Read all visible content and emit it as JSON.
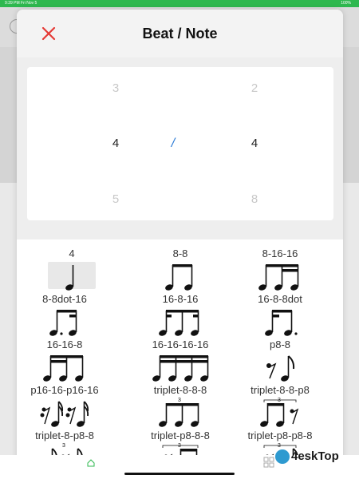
{
  "status_bar": {
    "left_text": "9:39 PM  Fri Nov 5",
    "right_text": "100%"
  },
  "modal": {
    "title": "Beat / Note",
    "close_icon": "close-x-icon"
  },
  "picker": {
    "left_column": [
      "3",
      "4",
      "5"
    ],
    "separator": "/",
    "right_column": [
      "2",
      "4",
      "8"
    ]
  },
  "notes": [
    {
      "label": "4",
      "selected": true
    },
    {
      "label": "8-8"
    },
    {
      "label": "8-16-16"
    },
    {
      "label": "8-8dot-16"
    },
    {
      "label": "16-8-16"
    },
    {
      "label": "16-8-8dot"
    },
    {
      "label": "16-16-8"
    },
    {
      "label": "16-16-16-16"
    },
    {
      "label": "p8-8"
    },
    {
      "label": "p16-16-p16-16"
    },
    {
      "label": "triplet-8-8-8"
    },
    {
      "label": "triplet-8-8-p8"
    },
    {
      "label": "triplet-8-p8-8"
    },
    {
      "label": "triplet-p8-8-8"
    },
    {
      "label": "triplet-p8-p8-8"
    }
  ],
  "tabbar": {
    "home_label": ""
  },
  "watermark": {
    "text": "4eskTop"
  },
  "colors": {
    "accent_green": "#2eb84f",
    "close_red": "#e53935",
    "separator_blue": "#2a7bd6"
  }
}
